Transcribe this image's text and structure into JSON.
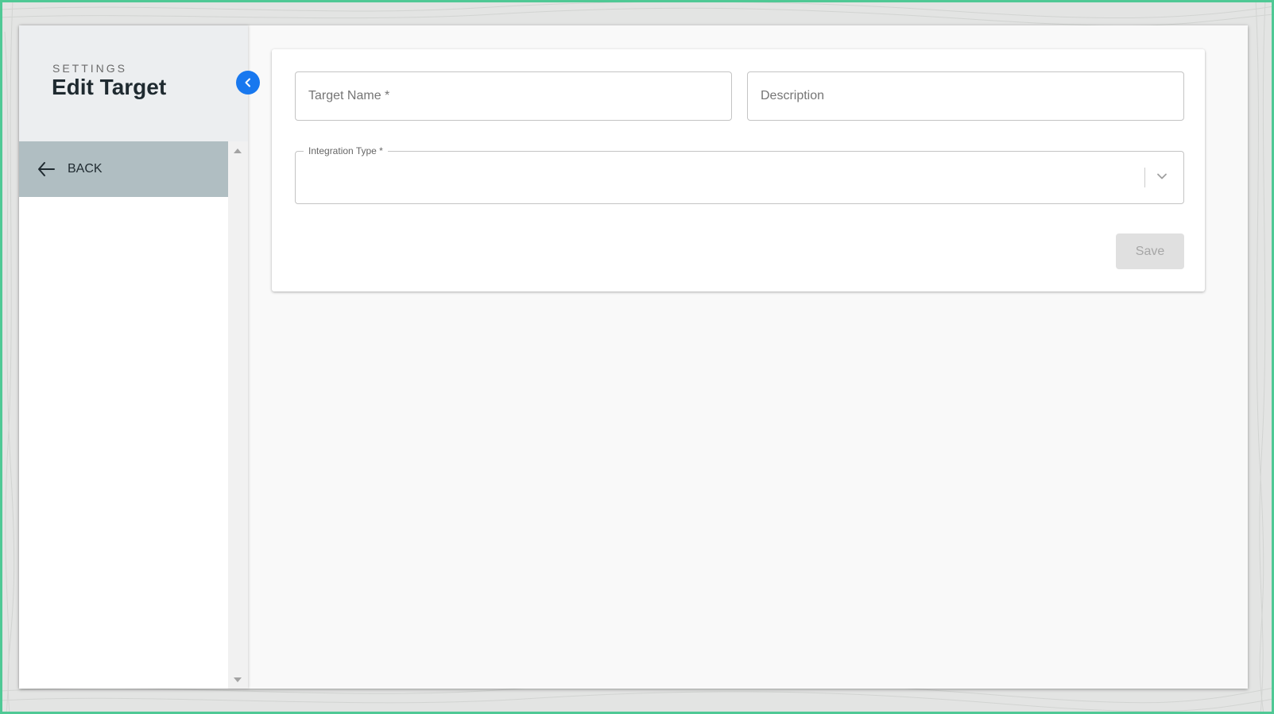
{
  "sidebar": {
    "kicker": "SETTINGS",
    "title": "Edit Target",
    "collapse_icon": "chevron-left-icon",
    "back": {
      "icon": "arrow-left-icon",
      "label": "BACK"
    }
  },
  "form": {
    "target_name": {
      "placeholder": "Target Name *",
      "value": ""
    },
    "description": {
      "placeholder": "Description",
      "value": ""
    },
    "integration_type": {
      "label": "Integration Type *",
      "value": "",
      "icon": "chevron-down-icon"
    },
    "save_label": "Save"
  },
  "colors": {
    "accent": "#1878ef",
    "frame_border": "#4fc995",
    "nav_active_bg": "#b0bec2",
    "sidebar_header_bg": "#eceef0",
    "save_disabled_bg": "#e0e0e0",
    "save_disabled_text": "#a6a6a6"
  }
}
